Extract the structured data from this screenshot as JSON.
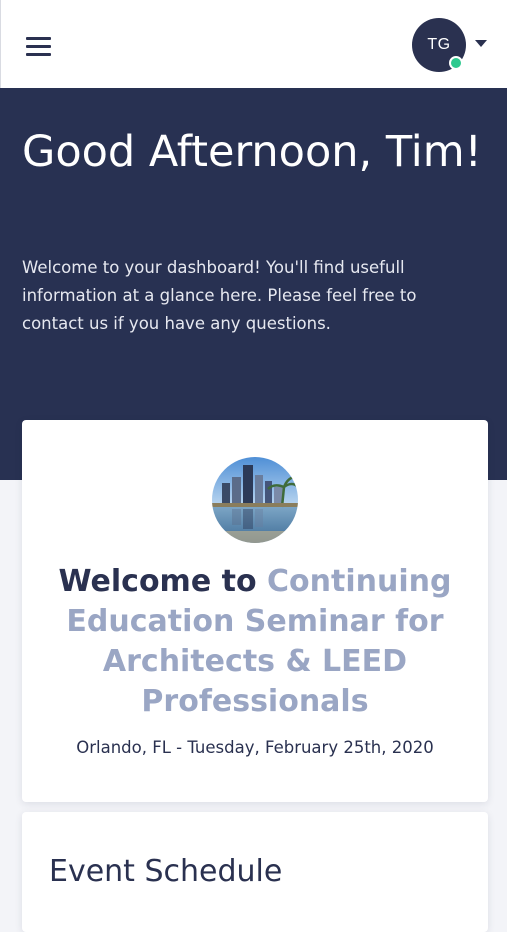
{
  "header": {
    "menu_icon": "hamburger-menu-icon",
    "user_initials": "TG",
    "status_color": "#2ec98f",
    "dropdown_icon": "caret-down-icon"
  },
  "hero": {
    "greeting": "Good Afternoon, Tim!",
    "message": "Welcome to your dashboard! You'll find usefull information at a glance here. Please feel free to contact us if you have any questions.",
    "background_color": "#283152"
  },
  "event_card": {
    "title_lead": "Welcome to",
    "title_event": "Continuing Education Seminar for Architects & LEED Professionals",
    "location_date": "Orlando, FL - Tuesday, February 25th, 2020",
    "accent_color": "#9aa6c4"
  },
  "schedule": {
    "title": "Event Schedule"
  }
}
